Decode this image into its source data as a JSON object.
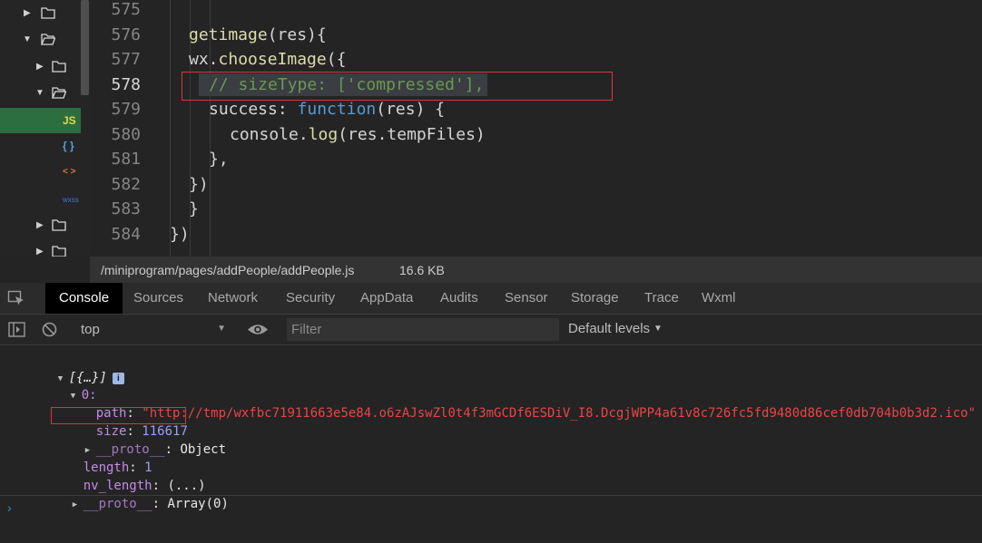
{
  "tree": {
    "items": [
      {
        "type": "folder",
        "expanded": false
      },
      {
        "type": "folder",
        "expanded": true
      },
      {
        "type": "folder",
        "expanded": false
      },
      {
        "type": "folder",
        "expanded": true
      },
      {
        "type": "file",
        "badge": "JS",
        "color": "#e8d44d",
        "selected": true
      },
      {
        "type": "file",
        "badge": "{ }",
        "color": "#4ea0e8"
      },
      {
        "type": "file",
        "badge": "< >",
        "color": "#e0724a"
      },
      {
        "type": "file",
        "badge": "wxss",
        "color": "#3b7bd6"
      },
      {
        "type": "folder",
        "expanded": false
      },
      {
        "type": "folder",
        "expanded": false
      },
      {
        "type": "folder",
        "expanded": false
      }
    ]
  },
  "editor": {
    "lines": [
      {
        "n": "575",
        "tokens": []
      },
      {
        "n": "576",
        "tokens": [
          {
            "c": "tk-fn",
            "t": "getimage"
          },
          {
            "c": "tk-plain",
            "t": "(res){"
          }
        ]
      },
      {
        "n": "577",
        "tokens": [
          {
            "c": "tk-plain",
            "t": "wx."
          },
          {
            "c": "tk-fn",
            "t": "chooseImage"
          },
          {
            "c": "tk-plain",
            "t": "({"
          }
        ]
      },
      {
        "n": "578",
        "tokens": [
          {
            "c": "tk-cmt",
            "t": "// sizeType: ['compressed'],"
          }
        ]
      },
      {
        "n": "579",
        "tokens": [
          {
            "c": "tk-prop",
            "t": "success: "
          },
          {
            "c": "tk-kw",
            "t": "function"
          },
          {
            "c": "tk-plain",
            "t": "(res) {"
          }
        ]
      },
      {
        "n": "580",
        "tokens": [
          {
            "c": "tk-plain",
            "t": "console."
          },
          {
            "c": "tk-fn",
            "t": "log"
          },
          {
            "c": "tk-plain",
            "t": "(res.tempFiles)"
          }
        ]
      },
      {
        "n": "581",
        "tokens": [
          {
            "c": "tk-plain",
            "t": "},"
          }
        ]
      },
      {
        "n": "582",
        "tokens": [
          {
            "c": "tk-plain",
            "t": "})"
          }
        ]
      },
      {
        "n": "583",
        "tokens": [
          {
            "c": "tk-plain",
            "t": "}"
          }
        ]
      },
      {
        "n": "584",
        "tokens": [
          {
            "c": "tk-plain",
            "t": "})"
          }
        ]
      }
    ],
    "current_line": "578"
  },
  "status": {
    "path": "/miniprogram/pages/addPeople/addPeople.js",
    "size": "16.6 KB"
  },
  "tabs": [
    {
      "label": "Console",
      "active": true
    },
    {
      "label": "Sources"
    },
    {
      "label": "Network"
    },
    {
      "label": "Security"
    },
    {
      "label": "AppData"
    },
    {
      "label": "Audits"
    },
    {
      "label": "Sensor"
    },
    {
      "label": "Storage"
    },
    {
      "label": "Trace"
    },
    {
      "label": "Wxml"
    }
  ],
  "console_toolbar": {
    "context": "top",
    "filter_placeholder": "Filter",
    "levels": "Default levels"
  },
  "console": {
    "root": "[{…}]",
    "info_icon": "i",
    "item0_key": "0:",
    "path_key": "path",
    "path_value": "\"http://tmp/wxfbc71911663e5e84.o6zAJswZl0t4f3mGCDf6ESDiV_I8.DcgjWPP4a61v8c726fc5fd9480d86cef0db704b0b3d2.ico\"",
    "size_key": "size",
    "size_value": "116617",
    "proto_key": "__proto__",
    "proto_obj": "Object",
    "length_key": "length",
    "length_value": "1",
    "nvlength_key": "nv_length",
    "nvlength_value": "(...)",
    "proto_arr": "Array(0)",
    "prompt": "›"
  }
}
